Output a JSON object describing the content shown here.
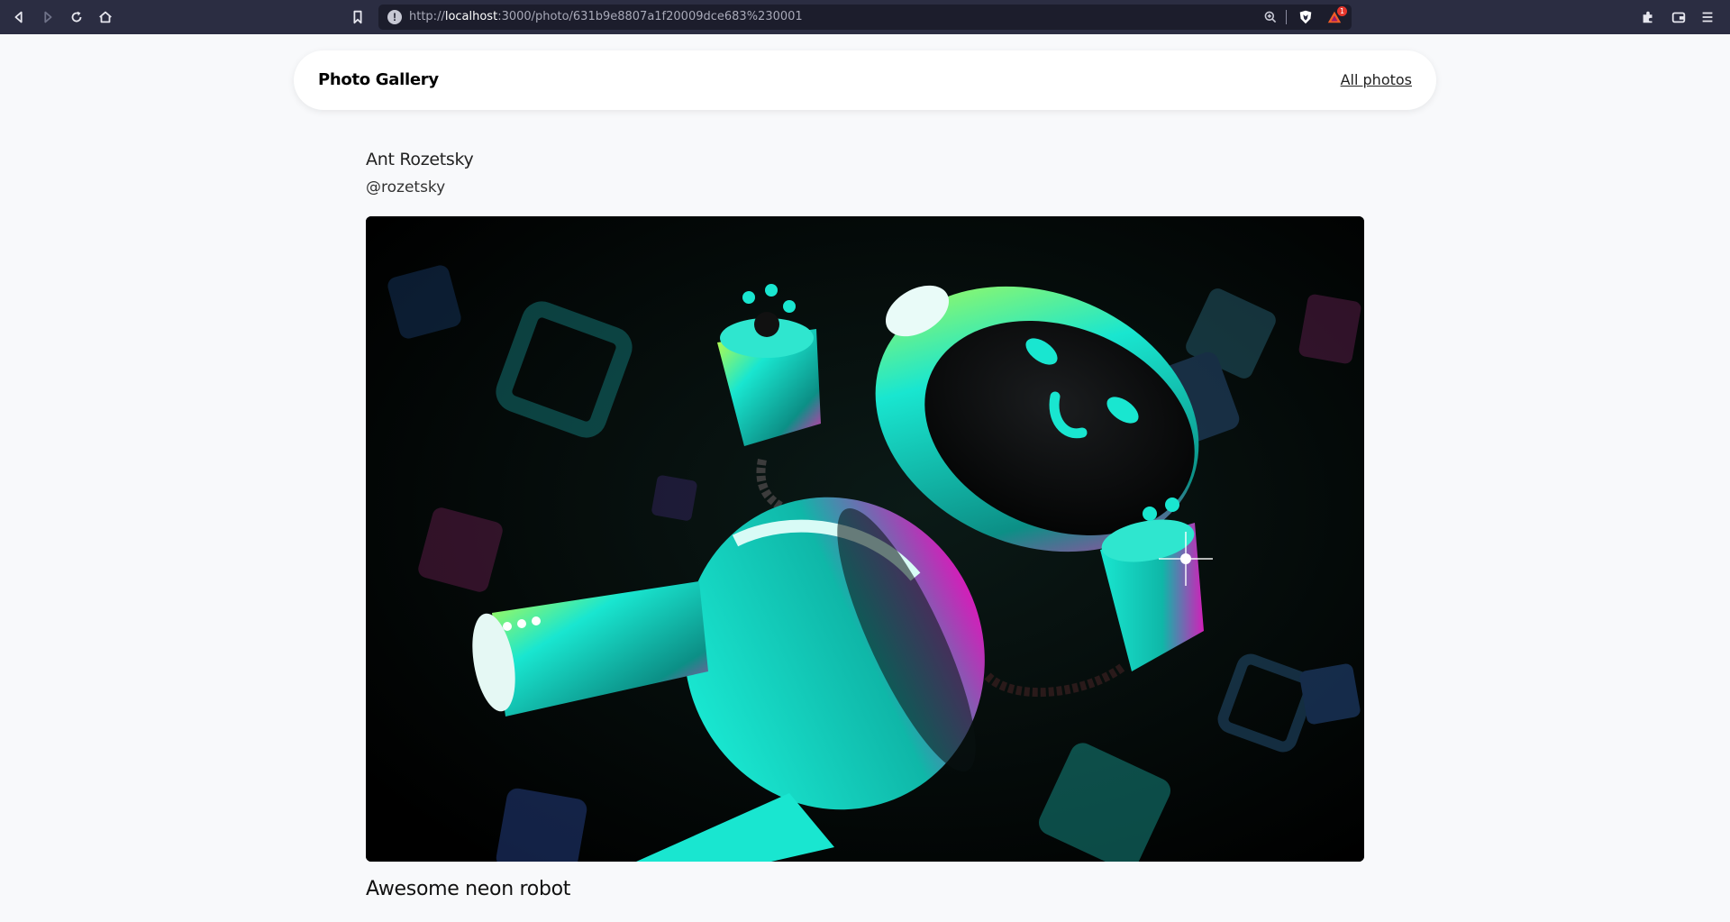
{
  "browser": {
    "url_prefix": "http://",
    "url_host": "localhost",
    "url_rest": ":3000/photo/631b9e8807a1f20009dce683%230001",
    "rewards_badge": "1",
    "icons": [
      "back-icon",
      "forward-icon",
      "reload-icon",
      "home-icon",
      "bookmark-icon",
      "info-icon",
      "zoom-icon",
      "brave-shield-icon",
      "rewards-icon",
      "extensions-icon",
      "wallet-icon",
      "menu-icon"
    ]
  },
  "navbar": {
    "brand": "Photo Gallery",
    "all_photos_link": "All photos"
  },
  "photo": {
    "author_name": "Ant Rozetsky",
    "author_handle": "@rozetsky",
    "caption": "Awesome neon robot"
  },
  "colors": {
    "page_bg": "#f8f9fb",
    "chrome_bg": "#2b2d42",
    "neon_teal": "#19e6d0",
    "neon_magenta": "#ff1fb4",
    "neon_lime": "#c8ff3a"
  }
}
